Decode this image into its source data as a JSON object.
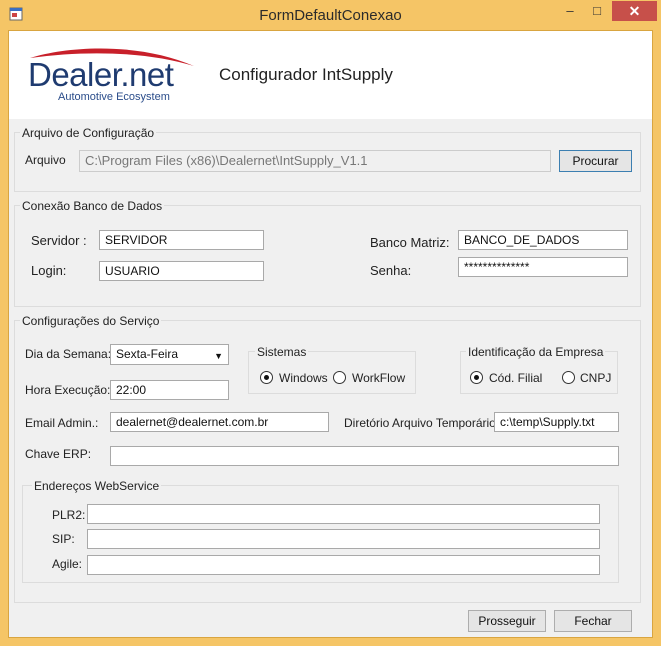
{
  "window": {
    "title": "FormDefaultConexao",
    "minimize": "–",
    "maximize": "□",
    "close": "✕"
  },
  "header": {
    "logo_main": "Dealer.net",
    "logo_sub": "Automotive Ecosystem",
    "title": "Configurador IntSupply"
  },
  "config_file": {
    "group_title": "Arquivo de Configuração",
    "label": "Arquivo",
    "path": "C:\\Program Files (x86)\\Dealernet\\IntSupply_V1.1",
    "browse_button": "Procurar"
  },
  "database": {
    "group_title": "Conexão Banco de Dados",
    "server_label": "Servidor :",
    "server_value": "SERVIDOR",
    "login_label": "Login:",
    "login_value": "USUARIO",
    "db_label": "Banco Matriz:",
    "db_value": "BANCO_DE_DADOS",
    "password_label": "Senha:",
    "password_value": "**************"
  },
  "service": {
    "group_title": "Configurações do Serviço",
    "weekday_label": "Dia da Semana:",
    "weekday_value": "Sexta-Feira",
    "time_label": "Hora Execução:",
    "time_value": "22:00",
    "systems": {
      "title": "Sistemas",
      "option_windows": "Windows",
      "option_workflow": "WorkFlow",
      "selected": "Windows"
    },
    "company_id": {
      "title": "Identificação da Empresa",
      "option_filial": "Cód. Filial",
      "option_cnpj": "CNPJ",
      "selected": "Cód. Filial"
    },
    "email_label": "Email Admin.:",
    "email_value": "dealernet@dealernet.com.br",
    "temp_dir_label": "Diretório Arquivo Temporário.:",
    "temp_dir_value": "c:\\temp\\Supply.txt",
    "erp_key_label": "Chave ERP:",
    "erp_key_value": "",
    "webservice": {
      "title": "Endereços WebService",
      "plr2_label": "PLR2:",
      "plr2_value": "",
      "sip_label": "SIP:",
      "sip_value": "",
      "agile_label": "Agile:",
      "agile_value": ""
    }
  },
  "footer": {
    "proceed_button": "Prosseguir",
    "close_button": "Fechar"
  },
  "colors": {
    "titlebar": "#f5c566",
    "close": "#c7504a",
    "logo_blue": "#1f3b70",
    "logo_swoosh": "#c8202a"
  }
}
